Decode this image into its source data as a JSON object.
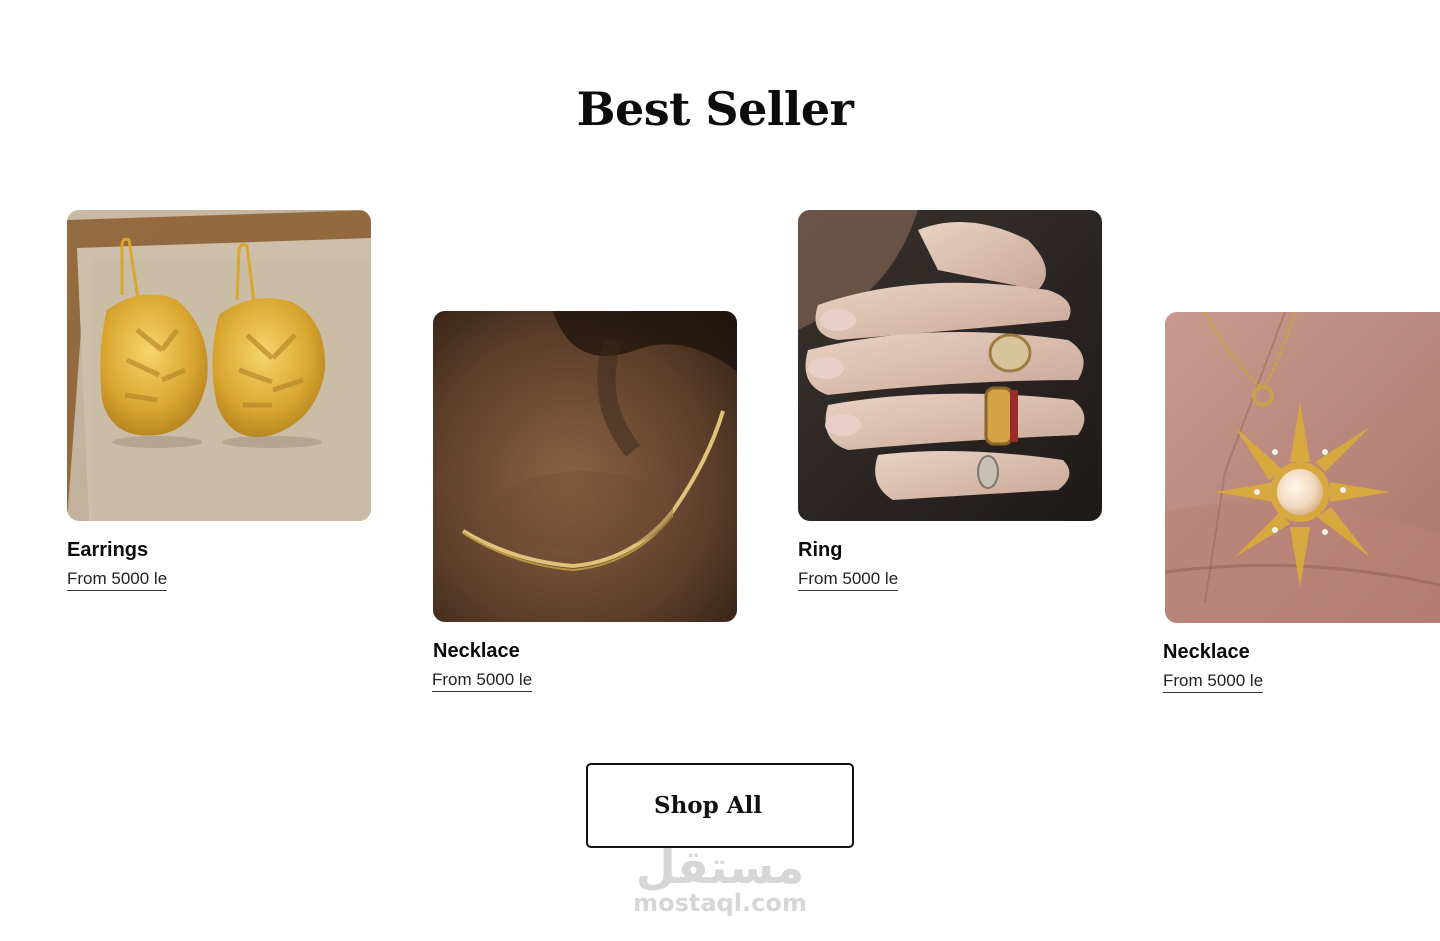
{
  "section": {
    "title": "Best Seller"
  },
  "products": [
    {
      "name": "Earrings",
      "price": "From 5000 le",
      "image_icon": "gold-leaf-earrings-photo"
    },
    {
      "name": "Necklace",
      "price": "From 5000 le",
      "image_icon": "gold-chain-necklace-photo"
    },
    {
      "name": "Ring",
      "price": "From 5000 le",
      "image_icon": "signet-rings-on-hand-photo"
    },
    {
      "name": "Necklace",
      "price": "From 5000 le",
      "image_icon": "sun-opal-pendant-photo"
    }
  ],
  "actions": {
    "shop_all_label": "Shop All"
  },
  "watermark": {
    "logo_text": "مستقل",
    "url_text": "mostaql.com"
  },
  "colors": {
    "background": "#ffffff",
    "text": "#111111",
    "gold": "#d4a53a",
    "watermark": "#c9c9c9"
  }
}
